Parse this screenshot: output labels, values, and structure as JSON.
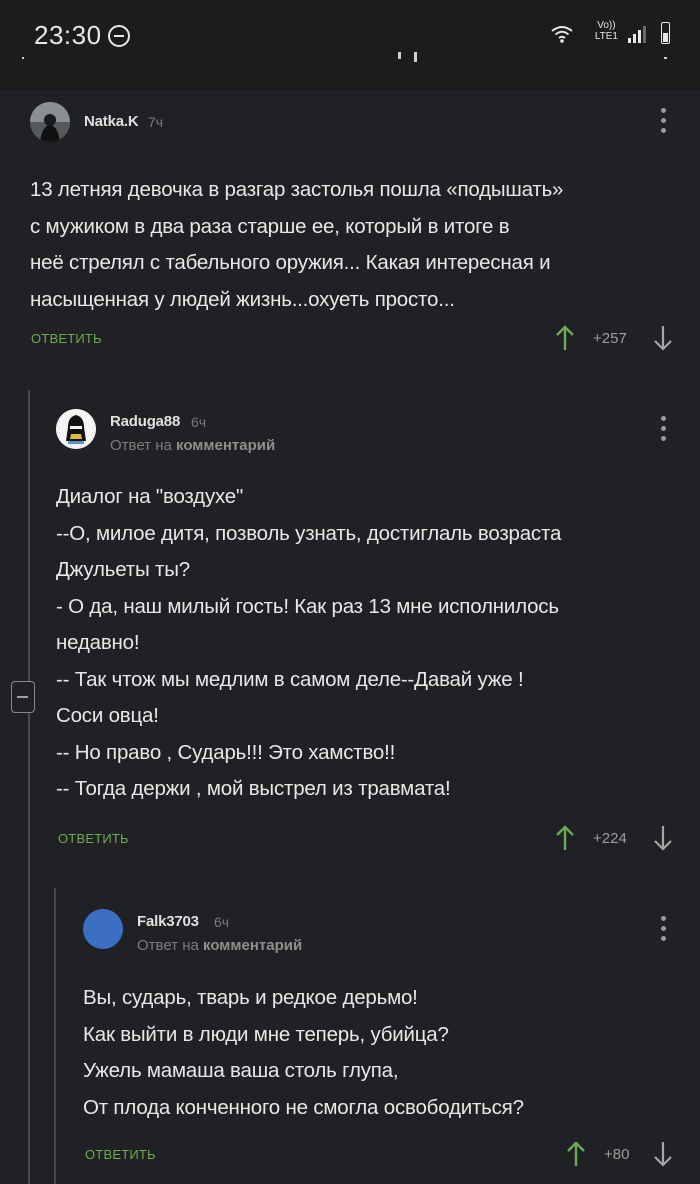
{
  "status_bar": {
    "time": "23:30",
    "network_line1": "Vo))",
    "network_line2": "LTE1"
  },
  "icons": {
    "dnd": "do-not-disturb-icon",
    "wifi": "wifi-icon",
    "signal": "signal-icon",
    "battery": "battery-icon",
    "more": "more-vertical-icon",
    "upvote": "arrow-up-icon",
    "downvote": "arrow-down-icon",
    "collapse": "collapse-thread-icon"
  },
  "colors": {
    "background": "#202124",
    "reply_green": "#6cab52",
    "upvote_green": "#6cab52",
    "avatar_blue": "#3b6fc4"
  },
  "comments": [
    {
      "username": "Natka.K",
      "time": "7ч",
      "text_lines": [
        "13 летняя девочка в разгар застолья пошла «подышать»",
        "с мужиком в два раза старше ее, который в итоге в",
        "неё стрелял с табельного оружия... Какая интересная и",
        "насыщенная у людей жизнь...охуеть просто..."
      ],
      "reply_label": "ОТВЕТИТЬ",
      "rating": "+257"
    },
    {
      "username": "Raduga88",
      "time": "6ч",
      "reply_prefix": "Ответ на",
      "reply_target": "комментарий",
      "text_lines": [
        "Диалог на \"воздухе\"",
        "--О, милое дитя, позволь узнать, достиглаль возраста",
        "Джульеты ты?",
        "- О да, наш милый гость! Как раз 13 мне исполнилось",
        "недавно!",
        "-- Так чтож мы медлим в самом деле--Давай уже !",
        "Соси овца!",
        "-- Но право , Сударь!!! Это хамство!!",
        "-- Тогда держи , мой выстрел из травмата!"
      ],
      "reply_label": "ОТВЕТИТЬ",
      "rating": "+224"
    },
    {
      "username": "Falk3703",
      "time": "6ч",
      "reply_prefix": "Ответ на",
      "reply_target": "комментарий",
      "text_lines": [
        "Вы, сударь, тварь и редкое дерьмо!",
        "Как выйти в люди мне теперь, убийца?",
        "Ужель мамаша ваша столь глупа,",
        "От плода конченного не смогла освободиться?"
      ],
      "reply_label": "ОТВЕТИТЬ",
      "rating": "+80"
    }
  ]
}
